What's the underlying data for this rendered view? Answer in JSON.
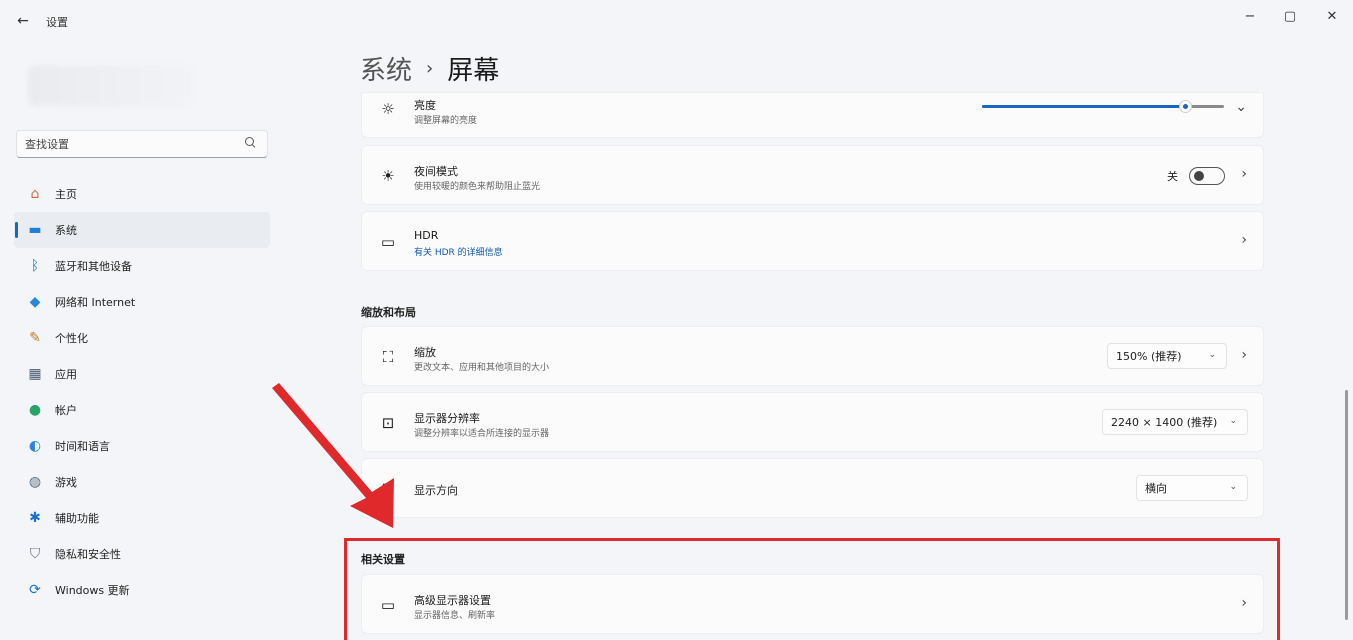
{
  "window": {
    "title": "设置",
    "back_glyph": "←",
    "minimize_glyph": "−",
    "maximize_glyph": "▢",
    "close_glyph": "✕"
  },
  "search": {
    "placeholder": "查找设置"
  },
  "sidebar": {
    "items": [
      {
        "label": "主页",
        "icon": "home-icon",
        "glyph": "⌂",
        "color": "#d06a3a"
      },
      {
        "label": "系统",
        "icon": "monitor-icon",
        "glyph": "▬",
        "color": "#1e7fd6",
        "active": true
      },
      {
        "label": "蓝牙和其他设备",
        "icon": "bluetooth-icon",
        "glyph": "ᛒ",
        "color": "#1a73d1"
      },
      {
        "label": "网络和 Internet",
        "icon": "wifi-icon",
        "glyph": "◆",
        "color": "#2a86d9"
      },
      {
        "label": "个性化",
        "icon": "brush-icon",
        "glyph": "✎",
        "color": "#c47a2c"
      },
      {
        "label": "应用",
        "icon": "apps-icon",
        "glyph": "▦",
        "color": "#4a5a70"
      },
      {
        "label": "帐户",
        "icon": "account-icon",
        "glyph": "●",
        "color": "#2aa36b"
      },
      {
        "label": "时间和语言",
        "icon": "globe-clock-icon",
        "glyph": "◐",
        "color": "#2a86d9"
      },
      {
        "label": "游戏",
        "icon": "gamepad-icon",
        "glyph": "◍",
        "color": "#5a6b80"
      },
      {
        "label": "辅助功能",
        "icon": "accessibility-icon",
        "glyph": "✱",
        "color": "#1a73d1"
      },
      {
        "label": "隐私和安全性",
        "icon": "shield-icon",
        "glyph": "⛉",
        "color": "#6b7380"
      },
      {
        "label": "Windows 更新",
        "icon": "windows-update-icon",
        "glyph": "⟳",
        "color": "#1a73d1"
      }
    ]
  },
  "header": {
    "parent": "系统",
    "separator": "›",
    "current": "屏幕"
  },
  "rows": {
    "brightness": {
      "title": "亮度",
      "subtitle": "调整屏幕的亮度",
      "level": 0.84,
      "chevron": "⌄"
    },
    "night_light": {
      "title": "夜间模式",
      "subtitle": "使用较暖的颜色来帮助阻止蓝光",
      "state": "关",
      "chevron": "›"
    },
    "hdr": {
      "title": "HDR",
      "subtitle": "有关 HDR 的详细信息",
      "chevron": "›"
    },
    "scale_section": "缩放和布局",
    "scale": {
      "title": "缩放",
      "subtitle": "更改文本、应用和其他项目的大小",
      "value": "150% (推荐)",
      "chevron": "›"
    },
    "resolution": {
      "title": "显示器分辨率",
      "subtitle": "调整分辨率以适合所连接的显示器",
      "value": "2240 × 1400 (推荐)"
    },
    "orientation": {
      "title": "显示方向",
      "value": "横向"
    },
    "related_section": "相关设置",
    "advanced": {
      "title": "高级显示器设置",
      "subtitle": "显示器信息、刷新率",
      "chevron": "›"
    }
  },
  "icons": {
    "brightness": "☼",
    "night_light": "☀",
    "hdr": "▭",
    "scale": "⛶",
    "resolution": "⊡",
    "orientation": "↻",
    "advanced": "▭",
    "dropdown": "⌄"
  },
  "colors": {
    "accent": "#1967c2",
    "annotation": "#e0292b"
  }
}
